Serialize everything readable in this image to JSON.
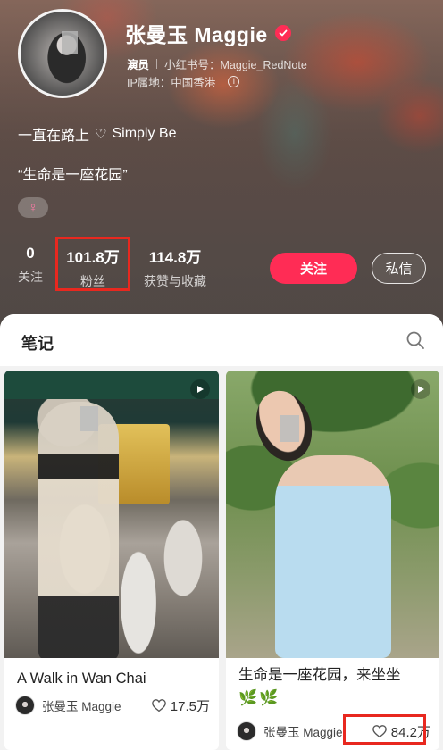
{
  "profile": {
    "name": "张曼玉 Maggie",
    "role_tag": "演员",
    "redbook_id": "小红书号：Maggie_RedNote",
    "ip_location": "IP属地：中国香港",
    "info_glyph": "i",
    "bio_line1_a": "一直在路上",
    "bio_heart": "♡",
    "bio_line1_b": "Simply Be",
    "bio_line2": "“生命是一座花园”",
    "gender_glyph": "♀",
    "stats": {
      "following": {
        "value": "0",
        "label": "关注"
      },
      "followers": {
        "value": "101.8万",
        "label": "粉丝"
      },
      "likes_collects": {
        "value": "114.8万",
        "label": "获赞与收藏"
      }
    },
    "follow_label": "关注",
    "message_label": "私信"
  },
  "notes_panel": {
    "tab_label": "笔记",
    "cards": [
      {
        "title": "A Walk in Wan Chai",
        "author": "张曼玉 Maggie",
        "likes": "17.5万",
        "type": "video"
      },
      {
        "title": "生命是一座花园，来坐坐",
        "emoji": "🌿🌿",
        "author": "张曼玉 Maggie",
        "likes": "84.2万",
        "type": "video"
      }
    ]
  },
  "colors": {
    "accent": "#ff2c55",
    "highlight_box": "#e8281f"
  },
  "icons": [
    "verified-icon",
    "info-icon",
    "female-icon",
    "search-icon",
    "play-icon",
    "heart-icon"
  ]
}
